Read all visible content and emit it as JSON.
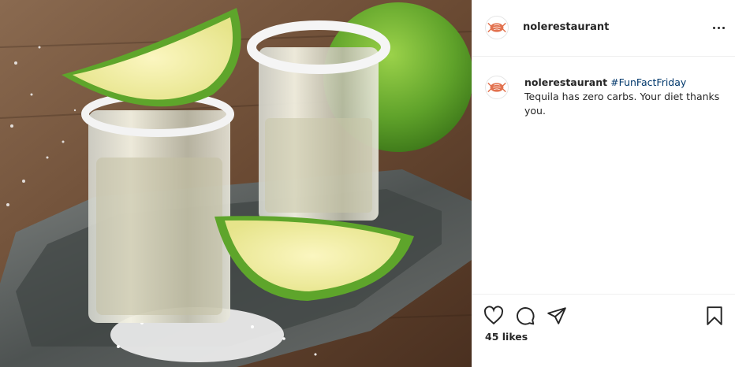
{
  "post": {
    "username": "nolerestaurant",
    "more_icon": "more-options-icon",
    "avatar_icon": "lobster-logo-icon"
  },
  "caption": {
    "username": "nolerestaurant",
    "hashtag": "#FunFactFriday",
    "text": " Tequila has zero carbs. Your diet thanks you."
  },
  "actions": {
    "like_icon": "heart-icon",
    "comment_icon": "comment-icon",
    "share_icon": "share-icon",
    "save_icon": "bookmark-icon",
    "likes_label": "45 likes"
  },
  "colors": {
    "lime": "#7dbb2f",
    "tray": "#5b5f5e",
    "wood": "#6b4a33",
    "brand": "#e2724f",
    "hashtag": "#00376b"
  }
}
